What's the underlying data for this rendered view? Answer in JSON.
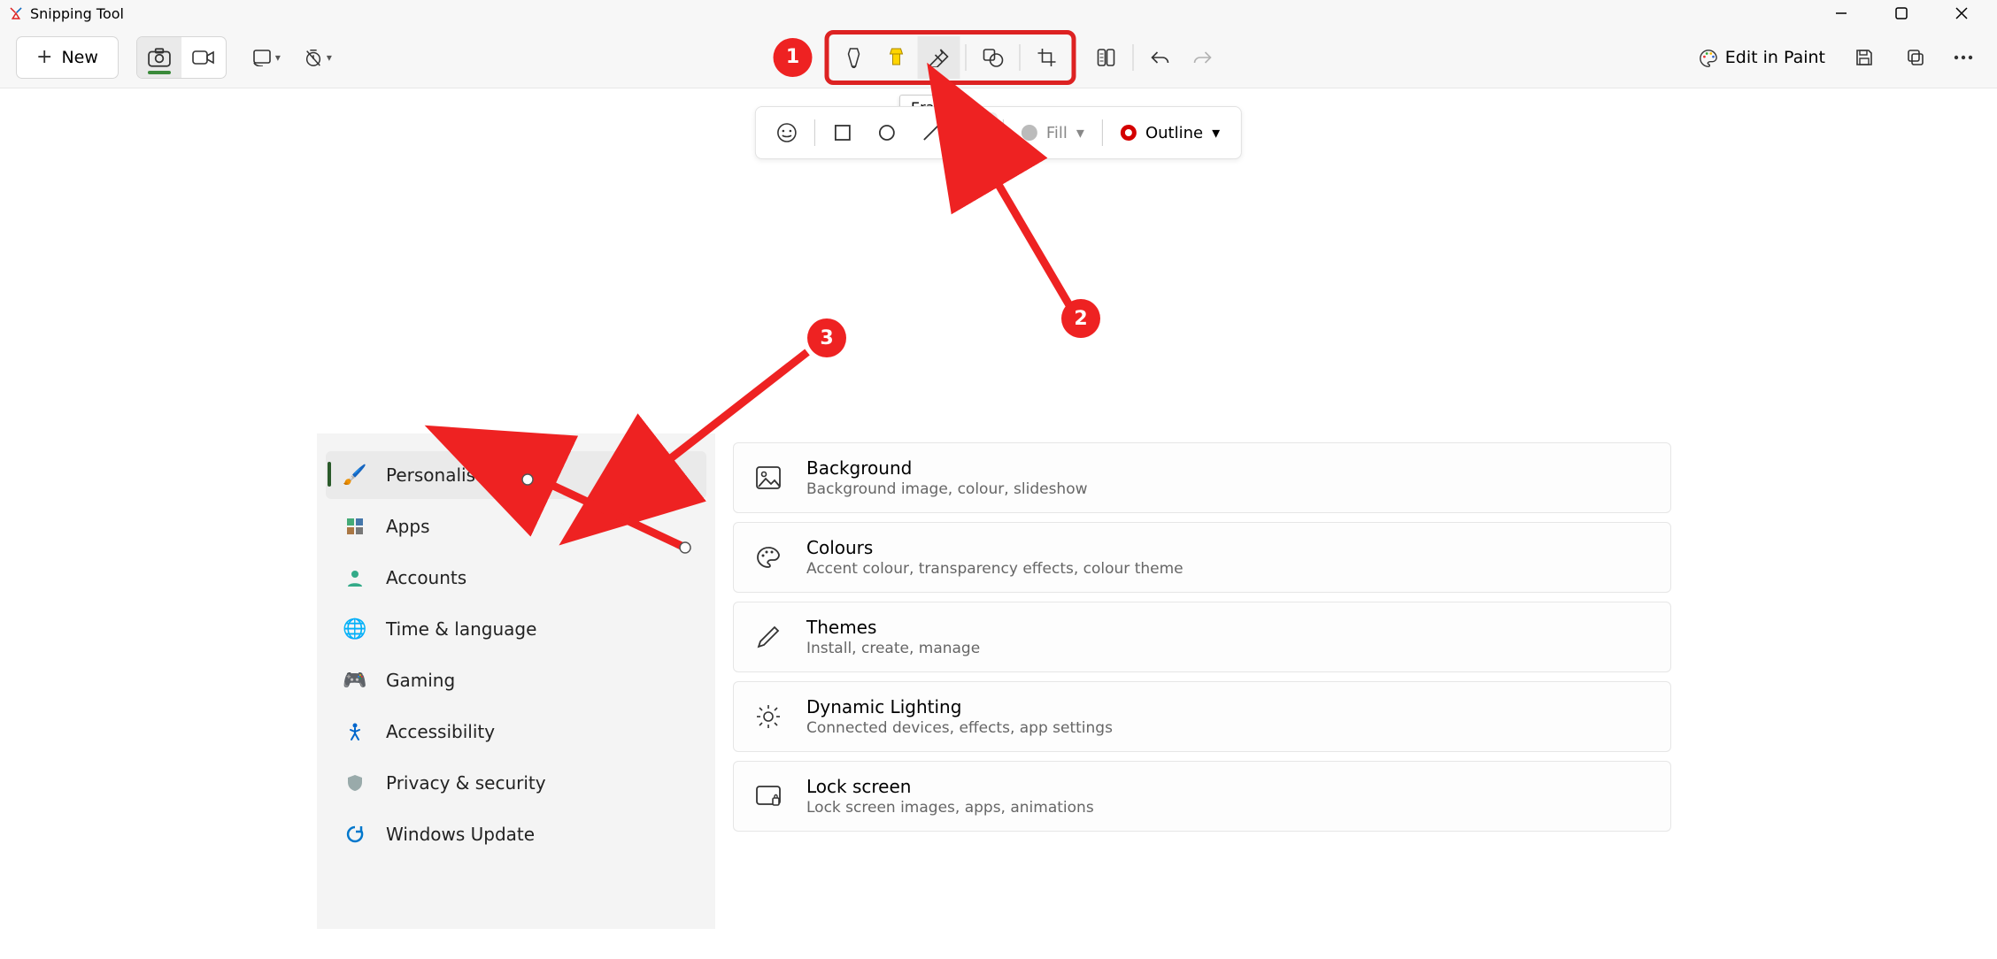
{
  "app": {
    "title": "Snipping Tool"
  },
  "toolbar": {
    "new_label": "New",
    "fill_label": "Fill",
    "outline_label": "Outline",
    "edit_paint_label": "Edit in Paint",
    "eraser_tooltip": "Eraser"
  },
  "badges": {
    "b1": "1",
    "b2": "2",
    "b3": "3"
  },
  "sidebar": {
    "items": [
      {
        "label": "Personalisation"
      },
      {
        "label": "Apps"
      },
      {
        "label": "Accounts"
      },
      {
        "label": "Time & language"
      },
      {
        "label": "Gaming"
      },
      {
        "label": "Accessibility"
      },
      {
        "label": "Privacy & security"
      },
      {
        "label": "Windows Update"
      }
    ]
  },
  "cards": [
    {
      "title": "Background",
      "sub": "Background image, colour, slideshow"
    },
    {
      "title": "Colours",
      "sub": "Accent colour, transparency effects, colour theme"
    },
    {
      "title": "Themes",
      "sub": "Install, create, manage"
    },
    {
      "title": "Dynamic Lighting",
      "sub": "Connected devices, effects, app settings"
    },
    {
      "title": "Lock screen",
      "sub": "Lock screen images, apps, animations"
    }
  ]
}
